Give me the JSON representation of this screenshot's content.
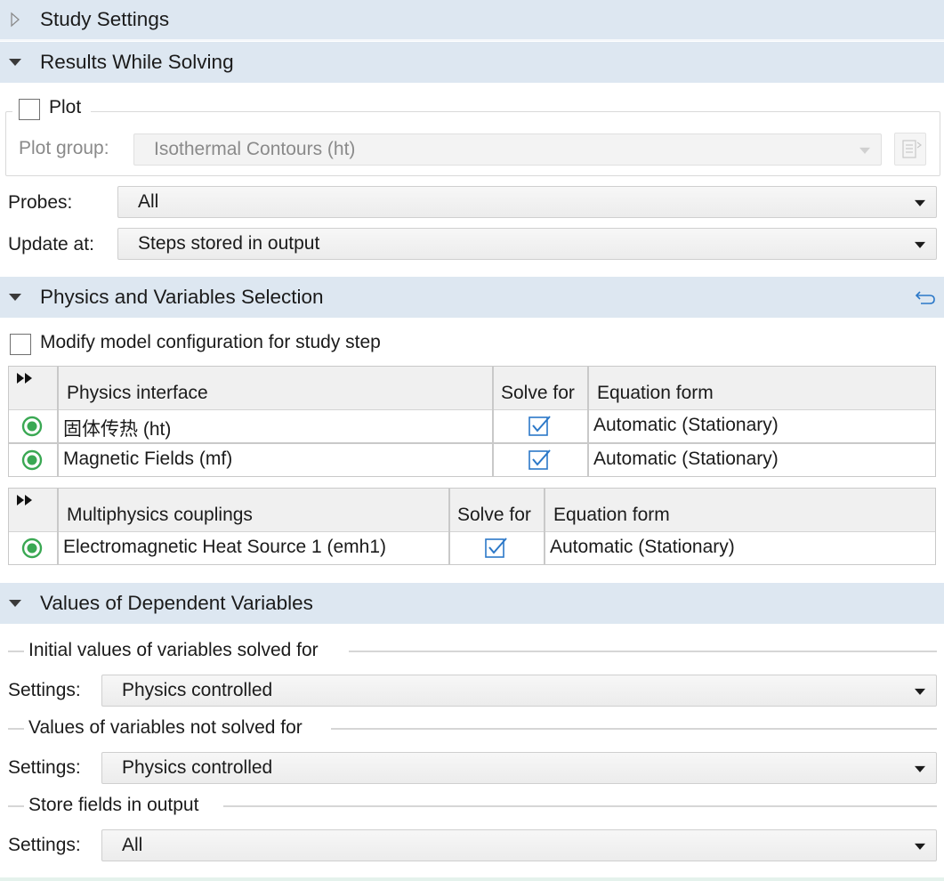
{
  "study_settings": {
    "title": "Study Settings"
  },
  "results_while_solving": {
    "title": "Results While Solving",
    "plot_label": "Plot",
    "plot_group_label": "Plot group:",
    "plot_group_value": "Isothermal Contours (ht)",
    "probes_label": "Probes:",
    "probes_value": "All",
    "update_at_label": "Update at:",
    "update_at_value": "Steps stored in output"
  },
  "physics_selection": {
    "title": "Physics and Variables Selection",
    "modify_label": "Modify model configuration for study step",
    "physics_table": {
      "headers": [
        "Physics interface",
        "Solve for",
        "Equation form"
      ],
      "rows": [
        {
          "name": "固体传热 (ht)",
          "equation": "Automatic (Stationary)"
        },
        {
          "name": "Magnetic Fields (mf)",
          "equation": "Automatic (Stationary)"
        }
      ]
    },
    "multiphysics_table": {
      "headers": [
        "Multiphysics couplings",
        "Solve for",
        "Equation form"
      ],
      "rows": [
        {
          "name": "Electromagnetic Heat Source 1 (emh1)",
          "equation": "Automatic (Stationary)"
        }
      ]
    }
  },
  "dependent_variables": {
    "title": "Values of Dependent Variables",
    "group1_title": "Initial values of variables solved for",
    "group2_title": "Values of variables not solved for",
    "group3_title": "Store fields in output",
    "settings_label": "Settings:",
    "settings1_value": "Physics controlled",
    "settings2_value": "Physics controlled",
    "settings3_value": "All"
  },
  "colors": {
    "header_bg": "#dde7f1",
    "accent_blue": "#2b78c8",
    "radio_green": "#3aa853"
  }
}
